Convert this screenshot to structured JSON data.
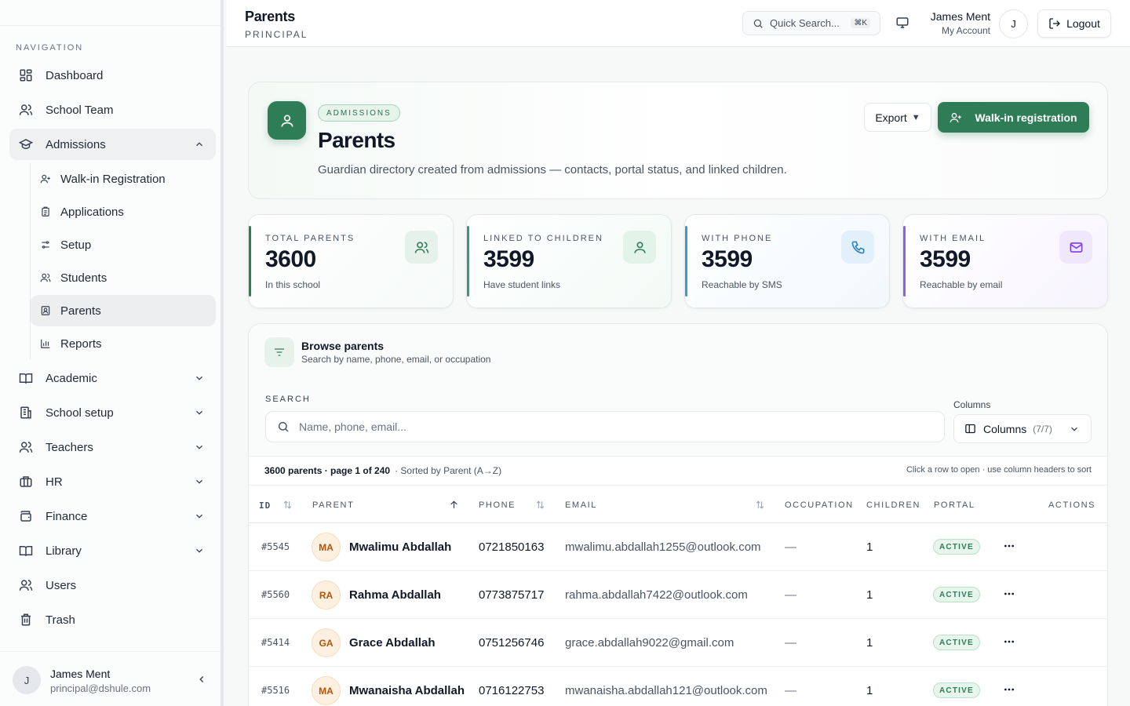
{
  "sidebar": {
    "nav_label": "NAVIGATION",
    "items": [
      {
        "label": "Dashboard",
        "icon": "dashboard-icon"
      },
      {
        "label": "School Team",
        "icon": "users-icon"
      },
      {
        "label": "Admissions",
        "icon": "graduation-cap-icon",
        "expanded": true
      },
      {
        "label": "Academic",
        "icon": "book-icon"
      },
      {
        "label": "School setup",
        "icon": "building-icon"
      },
      {
        "label": "Teachers",
        "icon": "users-icon"
      },
      {
        "label": "HR",
        "icon": "briefcase-icon"
      },
      {
        "label": "Finance",
        "icon": "wallet-icon"
      },
      {
        "label": "Library",
        "icon": "book-open-icon"
      },
      {
        "label": "Users",
        "icon": "users-icon"
      },
      {
        "label": "Trash",
        "icon": "trash-icon"
      }
    ],
    "sub_items": [
      {
        "label": "Walk-in Registration",
        "icon": "user-plus-icon"
      },
      {
        "label": "Applications",
        "icon": "clipboard-icon"
      },
      {
        "label": "Setup",
        "icon": "sliders-icon"
      },
      {
        "label": "Students",
        "icon": "users-icon"
      },
      {
        "label": "Parents",
        "icon": "contact-icon",
        "active": true
      },
      {
        "label": "Reports",
        "icon": "bar-chart-icon"
      }
    ],
    "user": {
      "initial": "J",
      "name": "James Ment",
      "email": "principal@dshule.com"
    }
  },
  "header": {
    "title": "Parents",
    "subtitle": "PRINCIPAL",
    "search_label": "Quick Search...",
    "shortcut": "⌘K",
    "user_name": "James Ment",
    "user_sub": "My Account",
    "avatar_initial": "J",
    "logout_label": "Logout"
  },
  "hero": {
    "tag": "ADMISSIONS",
    "title": "Parents",
    "description": "Guardian directory created from admissions — contacts, portal status, and linked children.",
    "export_label": "Export",
    "walkin_label": "Walk-in registration"
  },
  "stats": [
    {
      "label": "TOTAL PARENTS",
      "value": "3600",
      "sub": "In this school",
      "color": "#2f7d57",
      "icon": "users-icon"
    },
    {
      "label": "LINKED TO CHILDREN",
      "value": "3599",
      "sub": "Have student links",
      "color": "#2f9e72",
      "icon": "user-icon"
    },
    {
      "label": "WITH PHONE",
      "value": "3599",
      "sub": "Reachable by SMS",
      "color": "#3b9ccf",
      "icon": "phone-icon"
    },
    {
      "label": "WITH EMAIL",
      "value": "3599",
      "sub": "Reachable by email",
      "color": "#8b5cf6",
      "icon": "mail-icon"
    }
  ],
  "browse": {
    "title": "Browse parents",
    "subtitle": "Search by name, phone, email, or occupation",
    "search_label": "SEARCH",
    "search_placeholder": "Name, phone, email...",
    "columns_label": "Columns",
    "columns_button": "Columns",
    "columns_count": "(7/7)",
    "summary": "3600 parents · page 1 of 240",
    "sorted": "· Sorted by Parent (A→Z)",
    "hint": "Click a row to open · use column headers to sort"
  },
  "table": {
    "headers": {
      "id": "ID",
      "parent": "PARENT",
      "phone": "PHONE",
      "email": "EMAIL",
      "occupation": "OCCUPATION",
      "children": "CHILDREN",
      "portal": "PORTAL",
      "actions": "ACTIONS"
    },
    "rows": [
      {
        "id": "#5545",
        "initials": "MA",
        "name": "Mwalimu Abdallah",
        "phone": "0721850163",
        "email": "mwalimu.abdallah1255@outlook.com",
        "occupation": "—",
        "children": "1",
        "portal": "ACTIVE"
      },
      {
        "id": "#5560",
        "initials": "RA",
        "name": "Rahma Abdallah",
        "phone": "0773875717",
        "email": "rahma.abdallah7422@outlook.com",
        "occupation": "—",
        "children": "1",
        "portal": "ACTIVE"
      },
      {
        "id": "#5414",
        "initials": "GA",
        "name": "Grace Abdallah",
        "phone": "0751256746",
        "email": "grace.abdallah9022@gmail.com",
        "occupation": "—",
        "children": "1",
        "portal": "ACTIVE"
      },
      {
        "id": "#5516",
        "initials": "MA",
        "name": "Mwanaisha Abdallah",
        "phone": "0716122753",
        "email": "mwanaisha.abdallah121@outlook.com",
        "occupation": "—",
        "children": "1",
        "portal": "ACTIVE"
      }
    ]
  }
}
